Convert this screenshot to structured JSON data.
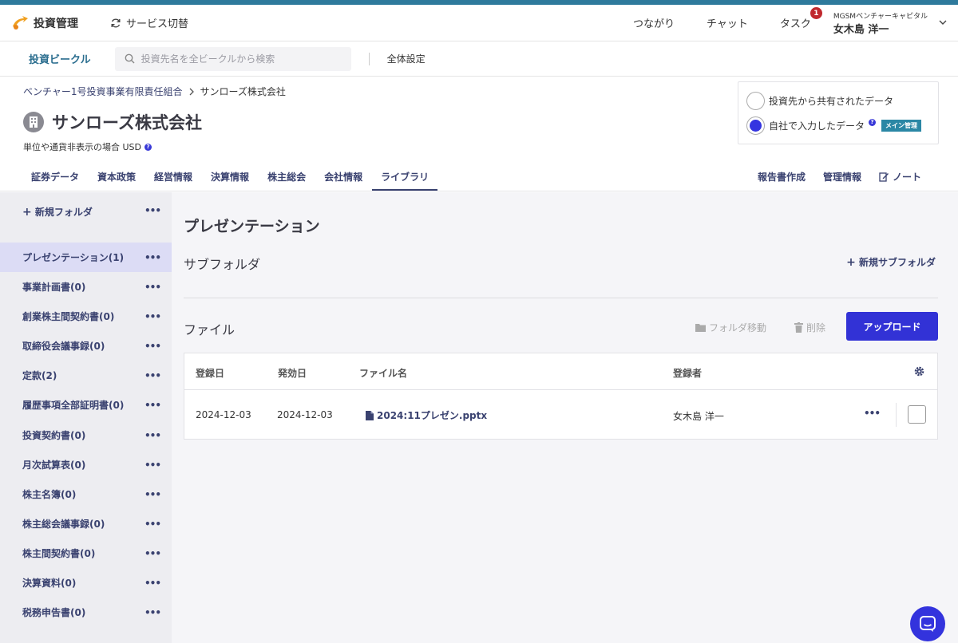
{
  "header": {
    "app_name": "投資管理",
    "service_switch": "サービス切替",
    "links": [
      "つながり",
      "チャット",
      "タスク"
    ],
    "task_badge": "1",
    "user_org": "MGSMベンチャーキャピタル",
    "user_name": "女木島 洋一"
  },
  "subnav": {
    "title": "投資ビークル",
    "search_placeholder": "投資先名を全ビークルから検索",
    "settings": "全体設定"
  },
  "company": {
    "breadcrumb_parent": "ベンチャー1号投資事業有限責任組合",
    "breadcrumb_current": "サンローズ株式会社",
    "name": "サンローズ株式会社",
    "unit_note": "単位や通貨非表示の場合 USD"
  },
  "data_source": {
    "option_shared": "投資先から共有されたデータ",
    "option_own": "自社で入力したデータ",
    "main_badge": "メイン管理",
    "selected": "own"
  },
  "tabs": [
    "証券データ",
    "資本政策",
    "経営情報",
    "決算情報",
    "株主総会",
    "会社情報",
    "ライブラリ"
  ],
  "active_tab": "ライブラリ",
  "tabs_right": [
    "報告書作成",
    "管理情報",
    "ノート"
  ],
  "sidebar": {
    "new_folder": "新規フォルダ",
    "folders": [
      "プレゼンテーション(1)",
      "事業計画書(0)",
      "創業株主間契約書(0)",
      "取締役会議事録(0)",
      "定款(2)",
      "履歴事項全部証明書(0)",
      "投資契約書(0)",
      "月次試算表(0)",
      "株主名簿(0)",
      "株主総会議事録(0)",
      "株主間契約書(0)",
      "決算資料(0)",
      "税務申告書(0)"
    ],
    "active_folder": "プレゼンテーション(1)"
  },
  "main": {
    "title": "プレゼンテーション",
    "subfolder_label": "サブフォルダ",
    "new_subfolder": "新規サブフォルダ",
    "file_label": "ファイル",
    "move_folder": "フォルダ移動",
    "delete": "削除",
    "upload": "アップロード",
    "columns": [
      "登録日",
      "発効日",
      "ファイル名",
      "登録者"
    ],
    "rows": [
      {
        "registered": "2024-12-03",
        "effective": "2024-12-03",
        "file_name": "2024:11プレゼン.pptx",
        "registrant": "女木島 洋一"
      }
    ]
  },
  "colors": {
    "top_stripe": "#2e7a9c",
    "accent": "#3232d6",
    "nav_text": "#3a4270",
    "main_badge": "#2b87a5",
    "sidebar_active": "#dcdcf5"
  }
}
